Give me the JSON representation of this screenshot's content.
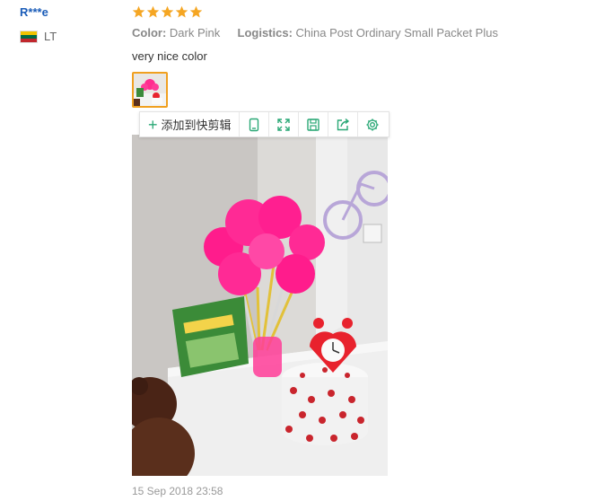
{
  "review": {
    "user_name": "R***e",
    "country_code": "LT",
    "rating": 5,
    "color_label": "Color:",
    "color_value": "Dark Pink",
    "logistics_label": "Logistics:",
    "logistics_value": "China Post Ordinary Small Packet Plus",
    "text": "very nice color",
    "date": "15 Sep 2018 23:58"
  },
  "toolbar": {
    "add_label": "添加到快剪辑",
    "icons": [
      "phone-icon",
      "fullscreen-icon",
      "save-icon",
      "share-icon",
      "settings-icon"
    ]
  },
  "colors": {
    "username": "#1a5cb8",
    "star": "#f5a623",
    "toolbar_accent": "#2aa876",
    "thumb_border": "#f0a020"
  }
}
